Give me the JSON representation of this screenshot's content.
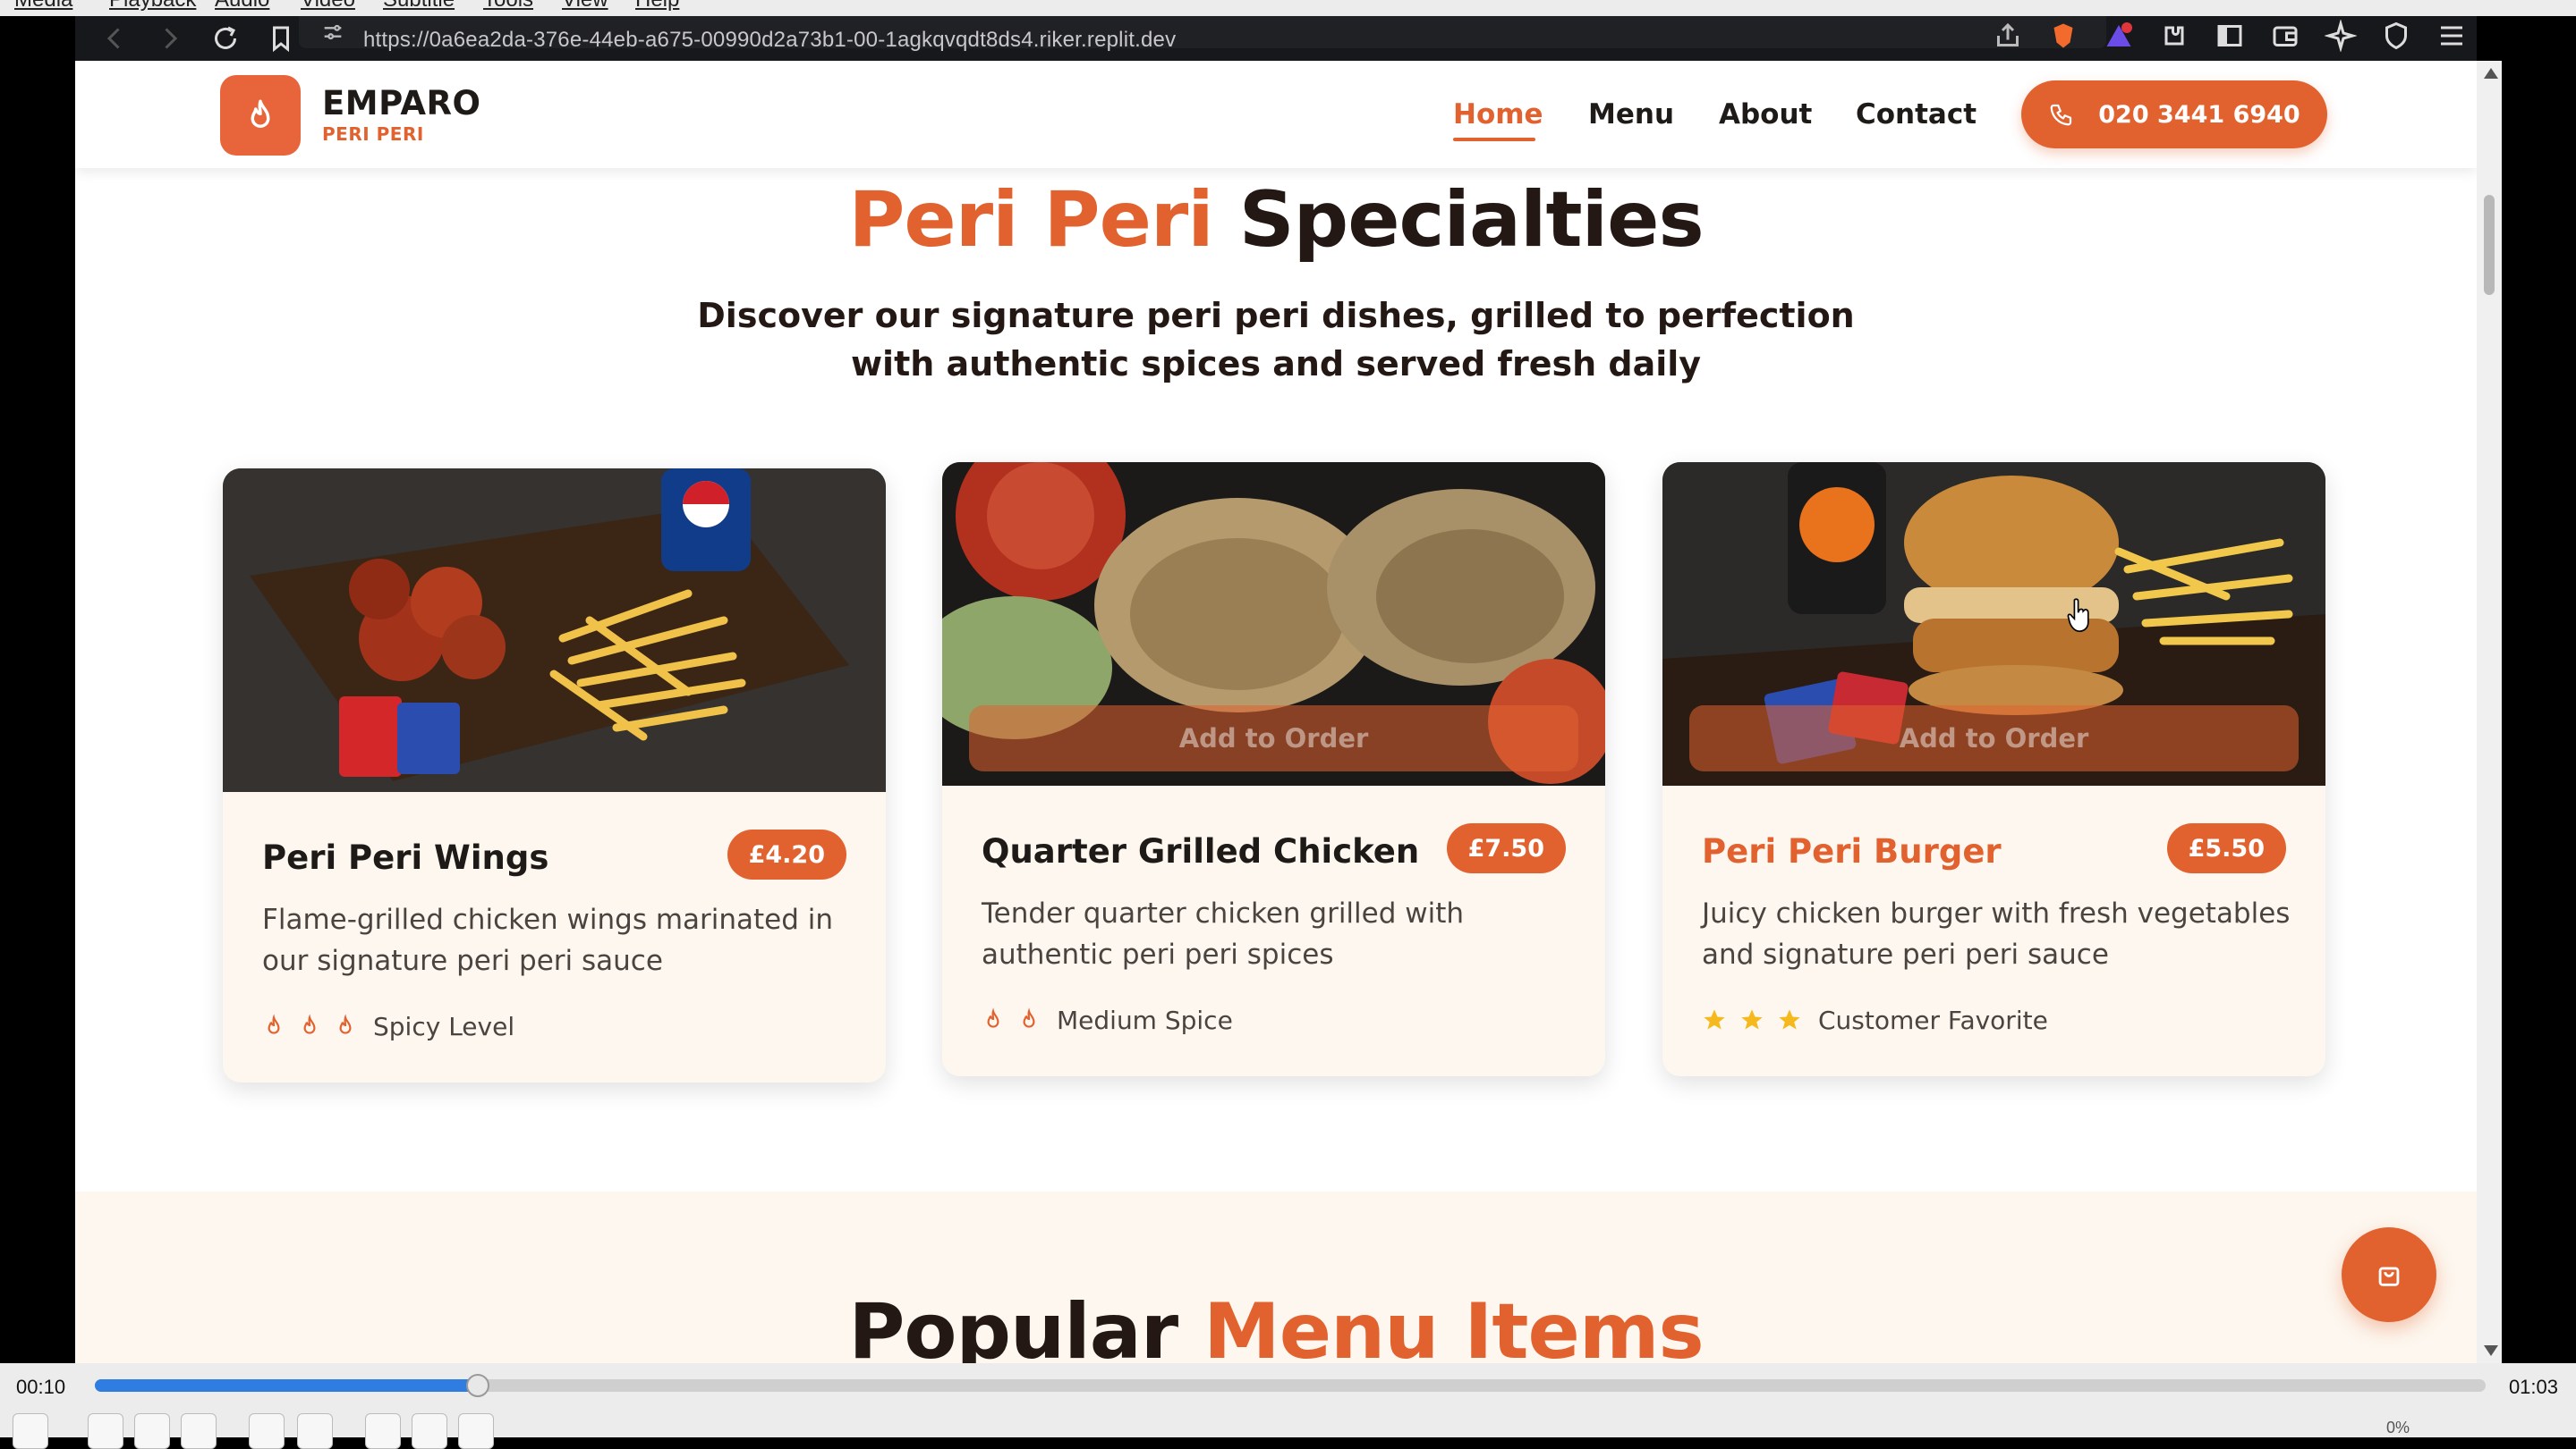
{
  "player": {
    "menu": [
      "Media",
      "Playback",
      "Audio",
      "Video",
      "Subtitle",
      "Tools",
      "View",
      "Help"
    ],
    "time_elapsed": "00:10",
    "time_total": "01:03",
    "progress_fraction": 0.16,
    "volume": "0%"
  },
  "browser": {
    "url": "https://0a6ea2da-376e-44eb-a675-00990d2a73b1-00-1agkqvqdt8ds4.riker.replit.dev"
  },
  "site": {
    "brand": "EMPARO",
    "brand_sub": "PERI PERI",
    "nav": [
      {
        "label": "Home",
        "active": true
      },
      {
        "label": "Menu",
        "active": false
      },
      {
        "label": "About",
        "active": false
      },
      {
        "label": "Contact",
        "active": false
      }
    ],
    "phone": "020 3441 6940",
    "accent_color": "#e2622f"
  },
  "specialties": {
    "title_accent": "Peri Peri",
    "title_rest": "Specialties",
    "subtitle": "Discover our signature peri peri dishes, grilled to perfection with authentic spices and served fresh daily",
    "add_label": "Add to Order",
    "cards": [
      {
        "name": "Peri Peri Wings",
        "price": "£4.20",
        "description": "Flame-grilled chicken wings marinated in our signature peri peri sauce",
        "meta_label": "Spicy Level",
        "meta_icon": "flame-icon",
        "meta_count": 3
      },
      {
        "name": "Quarter Grilled Chicken",
        "price": "£7.50",
        "description": "Tender quarter chicken grilled with authentic peri peri spices",
        "meta_label": "Medium Spice",
        "meta_icon": "flame-icon",
        "meta_count": 2
      },
      {
        "name": "Peri Peri Burger",
        "price": "£5.50",
        "description": "Juicy chicken burger with fresh vegetables and signature peri peri sauce",
        "meta_label": "Customer Favorite",
        "meta_icon": "star-icon",
        "meta_count": 3
      }
    ]
  },
  "popular": {
    "title_rest": "Popular",
    "title_accent": "Menu Items"
  }
}
